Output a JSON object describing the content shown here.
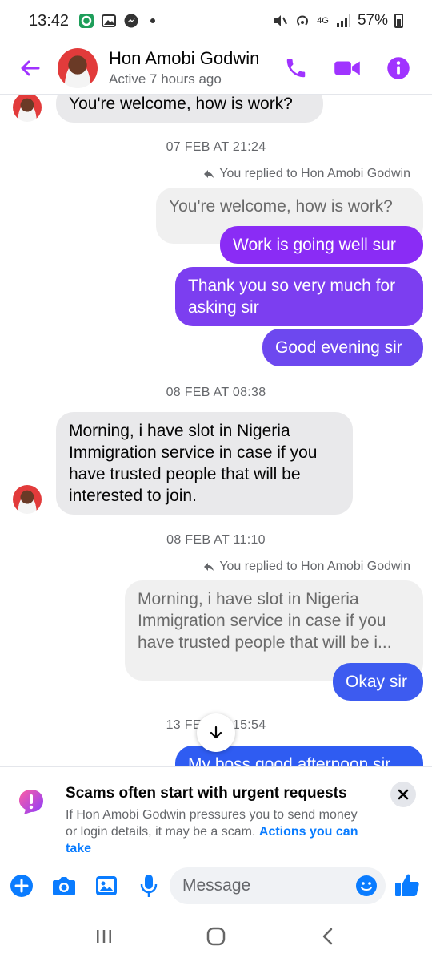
{
  "status_bar": {
    "time": "13:42",
    "network": "4G",
    "battery": "57%"
  },
  "header": {
    "name": "Hon Amobi Godwin",
    "status": "Active 7 hours ago"
  },
  "messages": {
    "top_partial": "You're welcome, how is work?",
    "date1": "07 FEB AT 21:24",
    "reply_note1": "You replied to Hon Amobi Godwin",
    "quote1": "You're welcome, how is work?",
    "out1": "Work is going well sur",
    "out2": "Thank you so very much for asking sir",
    "out3": "Good evening sir",
    "date2": "08 FEB AT 08:38",
    "in1": "Morning, i have slot in Nigeria Immigration service in case if you have trusted people that will be interested to join.",
    "date3": "08 FEB AT 11:10",
    "reply_note2": "You replied to Hon Amobi Godwin",
    "quote2": "Morning, i have slot in Nigeria Immigration service in case if you have trusted people that will be i...",
    "out4": "Okay sir",
    "date4": "13 FEB AT 15:54",
    "out5_partial": "My boss good afternoon sir"
  },
  "warning": {
    "title": "Scams often start with urgent requests",
    "body": "If Hon Amobi Godwin pressures you to send money or login details, it may be a scam.",
    "link": "Actions you can take"
  },
  "composer": {
    "placeholder": "Message"
  },
  "colors": {
    "accent": "#a033ff",
    "bubble_purple": "#8a2cf5",
    "bubble_violet": "#7c3ef0",
    "bubble_blue": "#3d5bf0",
    "link_blue": "#0a7cff"
  }
}
